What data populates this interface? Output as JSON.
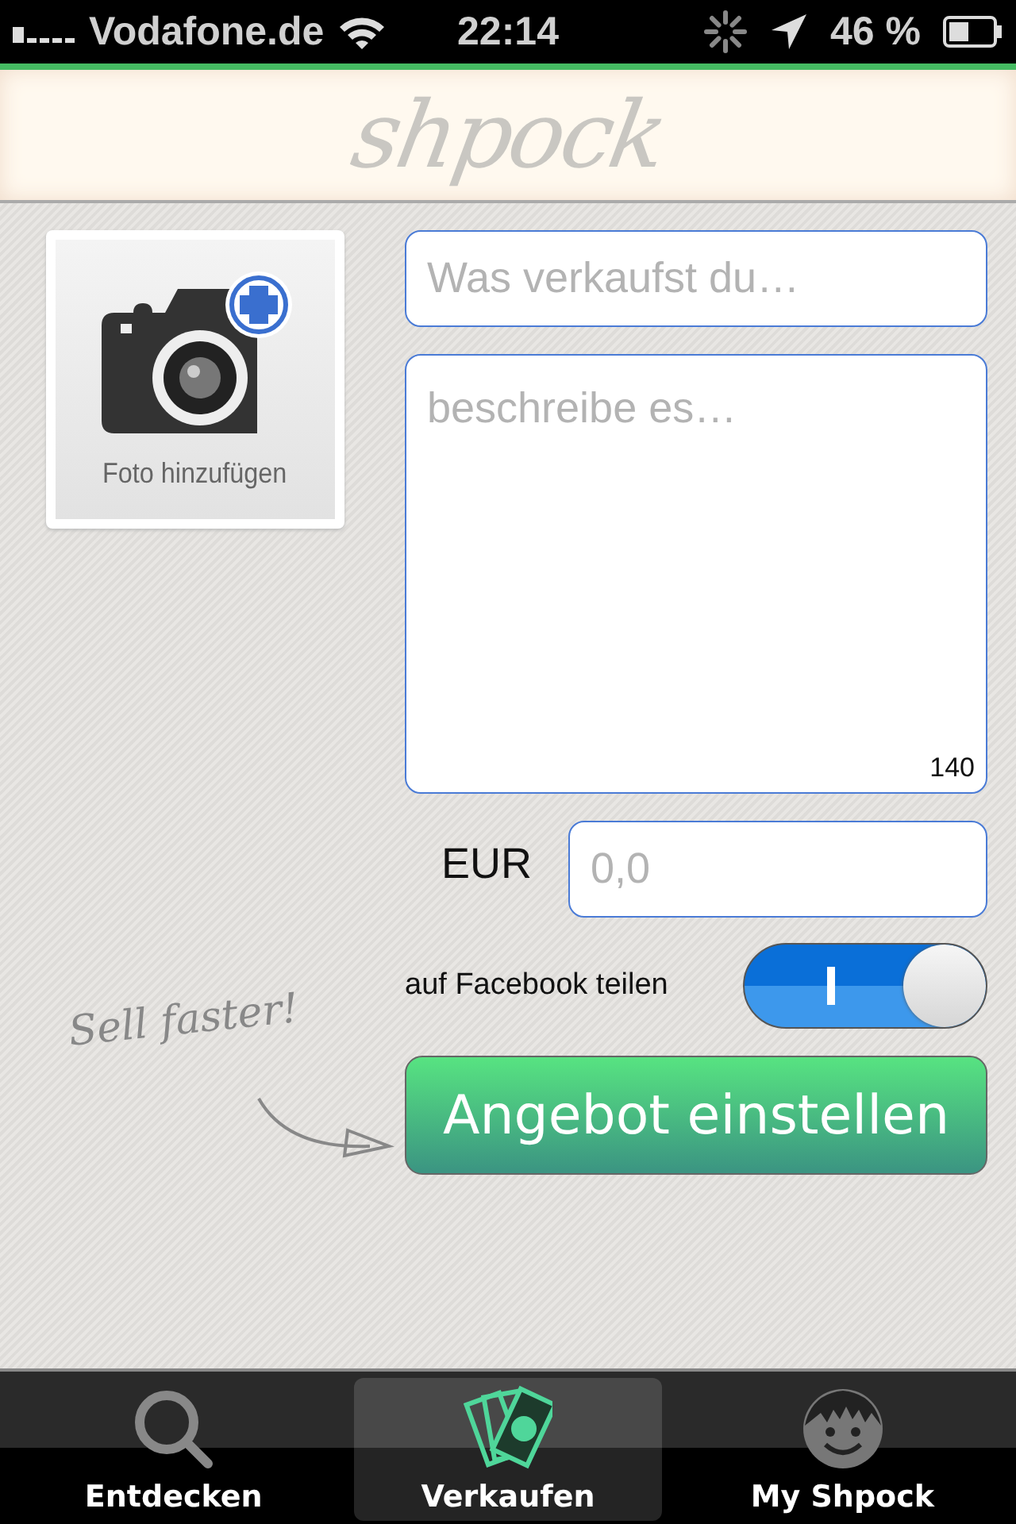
{
  "status_bar": {
    "carrier": "Vodafone.de",
    "time": "22:14",
    "battery": "46 %"
  },
  "header": {
    "logo": "shpock"
  },
  "photo": {
    "label": "Foto hinzufügen"
  },
  "title_field": {
    "placeholder": "Was verkaufst du…"
  },
  "description_field": {
    "placeholder": "beschreibe es…",
    "counter": "140"
  },
  "price": {
    "currency": "EUR",
    "placeholder": "0,0"
  },
  "hint": "Sell faster!",
  "facebook": {
    "label": "auf Facebook teilen",
    "on": true
  },
  "submit_button": "Angebot einstellen",
  "tabs": [
    {
      "label": "Entdecken",
      "kind": "search",
      "selected": false
    },
    {
      "label": "Verkaufen",
      "kind": "money",
      "selected": true
    },
    {
      "label": "My Shpock",
      "kind": "face",
      "selected": false
    }
  ]
}
